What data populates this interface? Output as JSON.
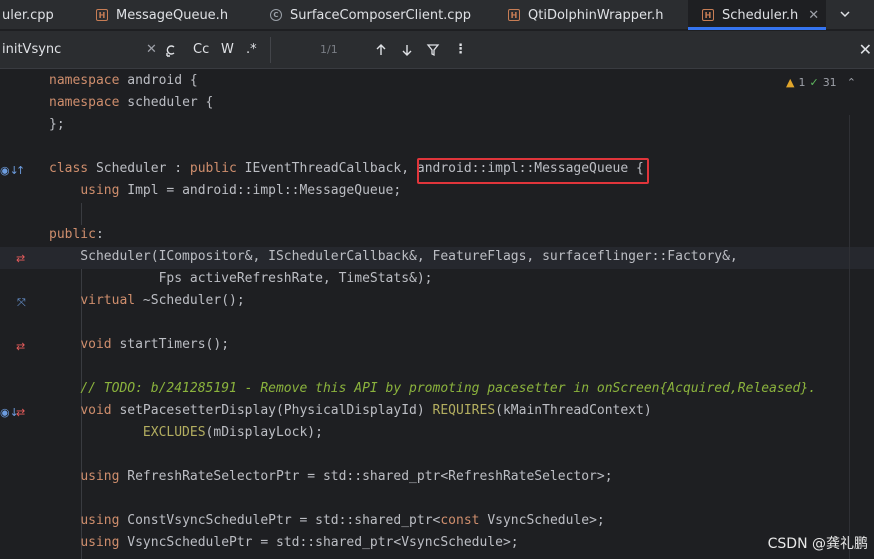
{
  "tabs": [
    {
      "label": "uler.cpp",
      "icon": "cpp-file-icon",
      "active": false
    },
    {
      "label": "MessageQueue.h",
      "icon": "header-file-icon",
      "active": false
    },
    {
      "label": "SurfaceComposerClient.cpp",
      "icon": "cpp-file-icon",
      "active": false
    },
    {
      "label": "QtiDolphinWrapper.h",
      "icon": "header-file-icon",
      "active": false
    },
    {
      "label": "Scheduler.h",
      "icon": "header-file-icon",
      "active": true
    }
  ],
  "find": {
    "query": "initVsync",
    "match_case_label": "Cc",
    "words_label": "W",
    "regex_label": ".*",
    "count": "1/1"
  },
  "inspections": {
    "warnings": "1",
    "checks": "31"
  },
  "code_lines": [
    "namespace android {",
    "namespace scheduler {",
    "};",
    "",
    "class Scheduler : public IEventThreadCallback, android::impl::MessageQueue {",
    "    using Impl = android::impl::MessageQueue;",
    "",
    "public:",
    "    Scheduler(ICompositor&, ISchedulerCallback&, FeatureFlags, surfaceflinger::Factory&,",
    "              Fps activeRefreshRate, TimeStats&);",
    "    virtual ~Scheduler();",
    "",
    "    void startTimers();",
    "",
    "    // TODO: b/241285191 - Remove this API by promoting pacesetter in onScreen{Acquired,Released}.",
    "    void setPacesetterDisplay(PhysicalDisplayId) REQUIRES(kMainThreadContext)",
    "            EXCLUDES(mDisplayLock);",
    "",
    "    using RefreshRateSelectorPtr = std::shared_ptr<RefreshRateSelector>;",
    "",
    "    using ConstVsyncSchedulePtr = std::shared_ptr<const VsyncSchedule>;",
    "    using VsyncSchedulePtr = std::shared_ptr<VsyncSchedule>;"
  ],
  "watermark": "CSDN @龚礼鹏"
}
